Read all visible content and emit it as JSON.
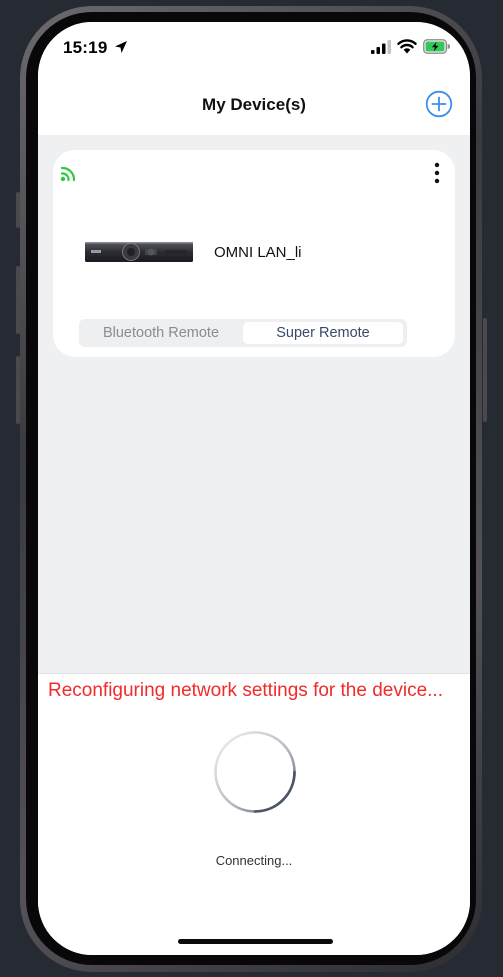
{
  "status_bar": {
    "time": "15:19",
    "icons": [
      "location-arrow-icon",
      "signal-icon",
      "wifi-icon",
      "battery-charging-icon"
    ]
  },
  "header": {
    "title": "My Device(s)",
    "add_icon": "add-circle-icon"
  },
  "device_card": {
    "connection_icon": "wifi-connected-icon",
    "menu_icon": "more-vertical-icon",
    "device_name": "OMNI LAN_li",
    "modes": [
      "Bluetooth Remote",
      "Super Remote"
    ],
    "selected_mode": "Super Remote"
  },
  "overlay": {
    "message": "Reconfiguring network settings for the device...",
    "status_text": "Connecting..."
  },
  "colors": {
    "accent": "#3d8ee8",
    "connected": "#2fc940",
    "warning_text": "#f22a2a",
    "background": "#eff0f2"
  }
}
